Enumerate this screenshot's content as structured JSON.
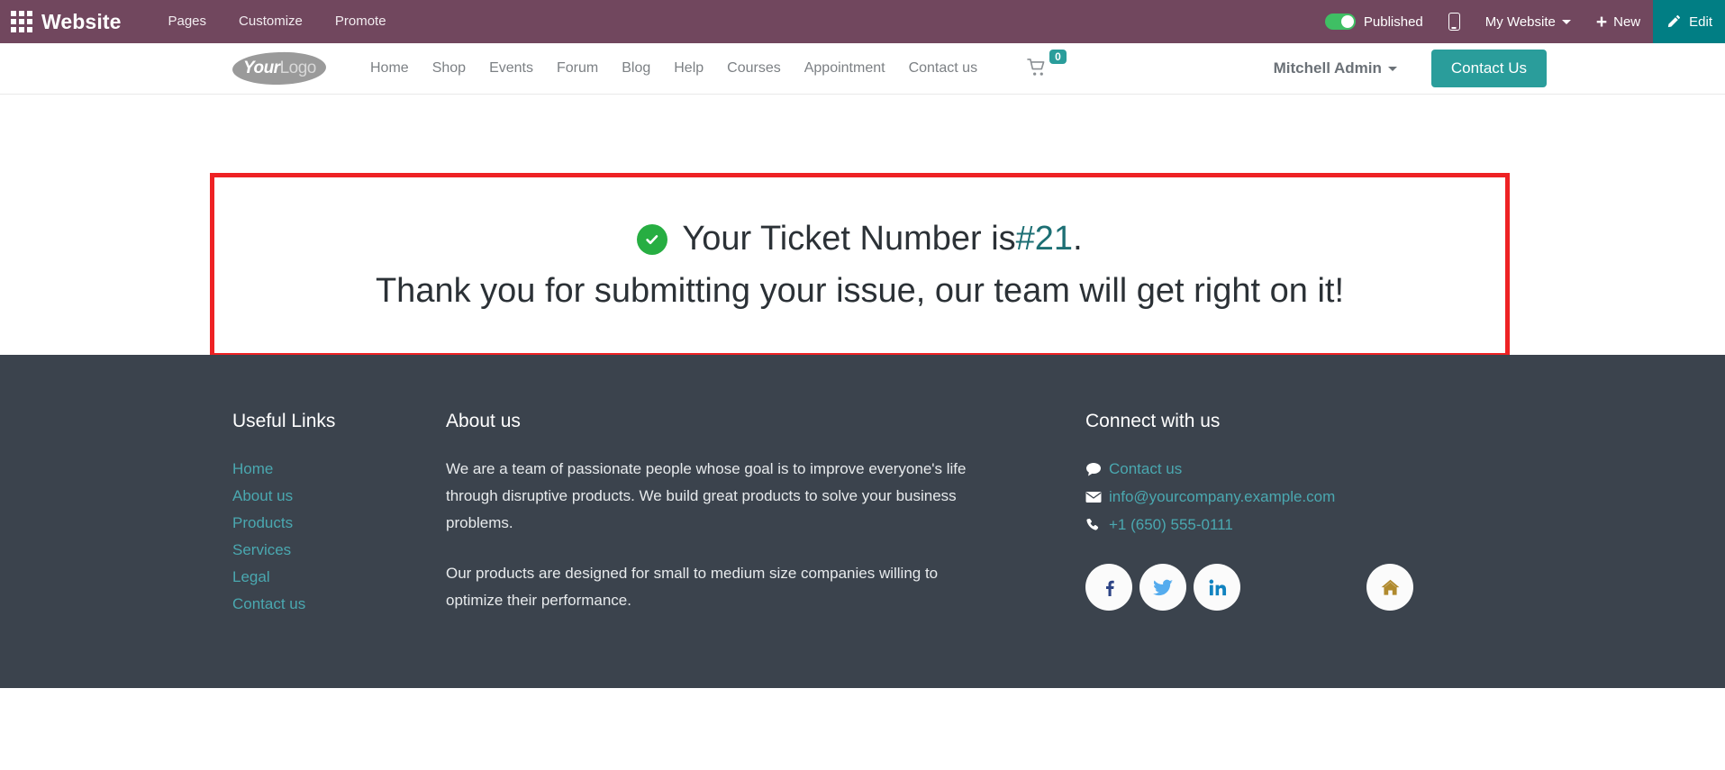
{
  "editor_bar": {
    "apps_icon": "apps-grid-icon",
    "brand": "Website",
    "menus": [
      "Pages",
      "Customize",
      "Promote"
    ],
    "published_label": "Published",
    "published_on": true,
    "mobile_icon": "mobile-preview-icon",
    "site_selector": "My Website",
    "new_label": "New",
    "new_icon": "plus-icon",
    "edit_label": "Edit",
    "edit_icon": "pencil-icon",
    "colors": {
      "bar": "#71475e",
      "edit": "#017e84",
      "toggle_on": "#3fbf64"
    }
  },
  "site_header": {
    "logo": {
      "primary": "Your",
      "secondary": "Logo"
    },
    "nav": [
      "Home",
      "Shop",
      "Events",
      "Forum",
      "Blog",
      "Help",
      "Courses",
      "Appointment",
      "Contact us"
    ],
    "cart_icon": "shopping-cart-icon",
    "cart_count": "0",
    "user_name": "Mitchell Admin",
    "cta_label": "Contact Us",
    "colors": {
      "accent": "#2a9d9b",
      "nav_text": "#7c8084"
    }
  },
  "main": {
    "alert": {
      "status_icon": "check-circle-icon",
      "prefix": "Your Ticket Number is ",
      "ticket_number": "#21",
      "suffix": ".",
      "thanks": "Thank you for submitting your issue, our team will get right on it!",
      "highlight_border_color": "#ee2224",
      "ticket_number_color": "#1d6f74",
      "check_color": "#27ae42"
    }
  },
  "footer": {
    "useful_links": {
      "title": "Useful Links",
      "items": [
        "Home",
        "About us",
        "Products",
        "Services",
        "Legal",
        "Contact us"
      ]
    },
    "about": {
      "title": "About us",
      "paragraph1": "We are a team of passionate people whose goal is to improve everyone's life through disruptive products. We build great products to solve your business problems.",
      "paragraph2": "Our products are designed for small to medium size companies willing to optimize their performance."
    },
    "connect": {
      "title": "Connect with us",
      "rows": [
        {
          "icon": "comment-icon",
          "label": "Contact us"
        },
        {
          "icon": "envelope-icon",
          "label": "info@yourcompany.example.com"
        },
        {
          "icon": "phone-icon",
          "label": "+1 (650) 555-0111"
        }
      ],
      "socials": [
        {
          "icon": "facebook-icon",
          "color": "#2d4486"
        },
        {
          "icon": "twitter-icon",
          "color": "#55acee"
        },
        {
          "icon": "linkedin-icon",
          "color": "#1183c0"
        },
        {
          "icon": "home-icon",
          "color": "#b08a2e"
        }
      ]
    },
    "colors": {
      "background": "#3b434d",
      "link": "#4aa8b0",
      "text": "#e7eaec"
    }
  }
}
